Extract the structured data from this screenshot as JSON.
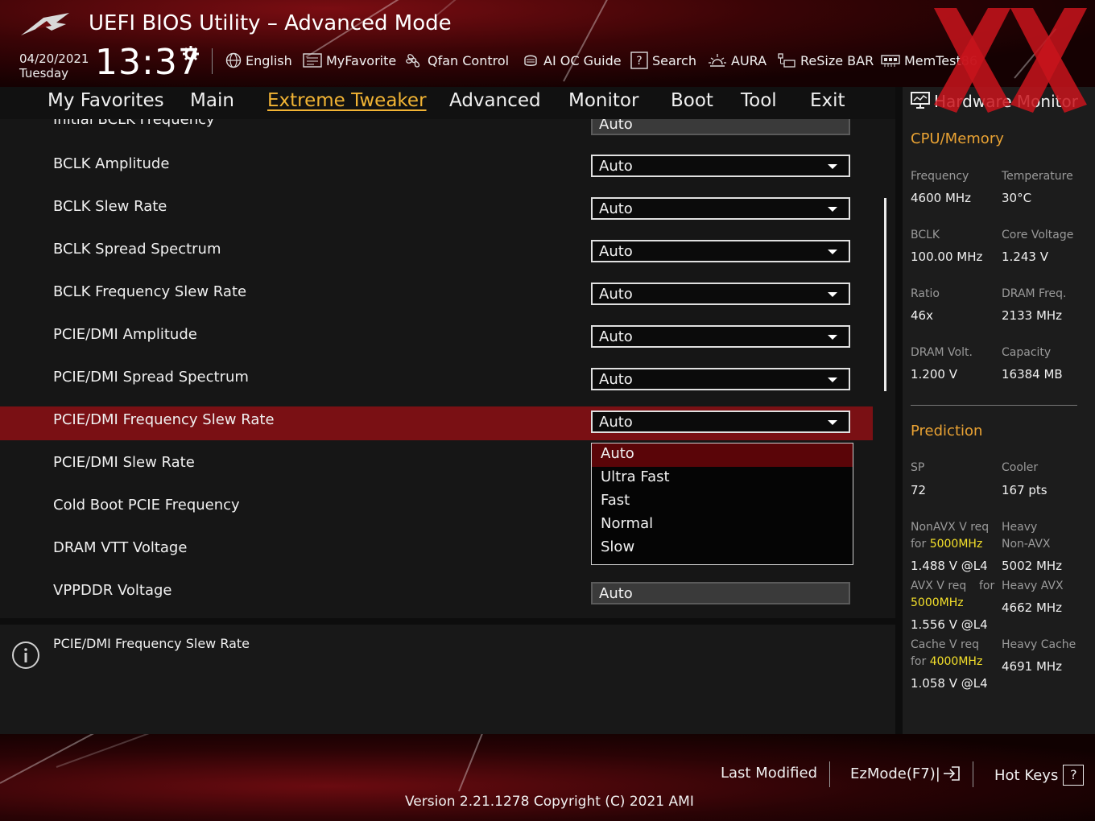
{
  "header": {
    "title": "UEFI BIOS Utility – Advanced Mode",
    "date": "04/20/2021",
    "day": "Tuesday",
    "time": "13:37",
    "tools": [
      {
        "label": "English",
        "icon": "globe-icon"
      },
      {
        "label": "MyFavorite",
        "icon": "favorite-icon"
      },
      {
        "label": "Qfan Control",
        "icon": "fan-icon"
      },
      {
        "label": "AI OC Guide",
        "icon": "ai-oc-icon"
      },
      {
        "label": "Search",
        "icon": "search-icon"
      },
      {
        "label": "AURA",
        "icon": "aura-icon"
      },
      {
        "label": "ReSize BAR",
        "icon": "resize-bar-icon"
      },
      {
        "label": "MemTest86",
        "icon": "memtest-icon"
      }
    ]
  },
  "nav": {
    "tabs": [
      "My Favorites",
      "Main",
      "Extreme Tweaker",
      "Advanced",
      "Monitor",
      "Boot",
      "Tool",
      "Exit"
    ],
    "active": "Extreme Tweaker"
  },
  "settings": {
    "partial_label": "Initial BCLK Frequency",
    "partial_value": "Auto",
    "rows": [
      {
        "label": "BCLK Amplitude",
        "value": "Auto"
      },
      {
        "label": "BCLK Slew Rate",
        "value": "Auto"
      },
      {
        "label": "BCLK Spread Spectrum",
        "value": "Auto"
      },
      {
        "label": "BCLK Frequency Slew Rate",
        "value": "Auto"
      },
      {
        "label": "PCIE/DMI Amplitude",
        "value": "Auto"
      },
      {
        "label": "PCIE/DMI Spread Spectrum",
        "value": "Auto"
      },
      {
        "label": "PCIE/DMI Frequency Slew Rate",
        "value": "Auto"
      },
      {
        "label": "PCIE/DMI Slew Rate",
        "value": ""
      },
      {
        "label": "Cold Boot PCIE Frequency",
        "value": ""
      },
      {
        "label": "DRAM VTT Voltage",
        "value": ""
      },
      {
        "label": "VPPDDR Voltage",
        "value": "Auto"
      }
    ],
    "dropdown_options": [
      "Auto",
      "Ultra Fast",
      "Fast",
      "Normal",
      "Slow"
    ],
    "dropdown_selected": "Auto"
  },
  "help": {
    "text": "PCIE/DMI Frequency Slew Rate"
  },
  "hardware_monitor": {
    "title": "Hardware Monitor",
    "cpu_memory": {
      "heading": "CPU/Memory",
      "frequency_label": "Frequency",
      "frequency": "4600 MHz",
      "temperature_label": "Temperature",
      "temperature": "30°C",
      "bclk_label": "BCLK",
      "bclk": "100.00 MHz",
      "core_voltage_label": "Core Voltage",
      "core_voltage": "1.243 V",
      "ratio_label": "Ratio",
      "ratio": "46x",
      "dram_freq_label": "DRAM Freq.",
      "dram_freq": "2133 MHz",
      "dram_volt_label": "DRAM Volt.",
      "dram_volt": "1.200 V",
      "capacity_label": "Capacity",
      "capacity": "16384 MB"
    },
    "prediction": {
      "heading": "Prediction",
      "sp_label": "SP",
      "sp": "72",
      "cooler_label": "Cooler",
      "cooler": "167 pts",
      "nonavx_req_label": "NonAVX V req",
      "nonavx_for": "for",
      "nonavx_freq": "5000MHz",
      "nonavx_value": "1.488 V @L4",
      "heavy_nonavx_label_1": "Heavy",
      "heavy_nonavx_label_2": "Non-AVX",
      "heavy_nonavx": "5002 MHz",
      "avx_req_label": "AVX V req",
      "avx_for": "for",
      "avx_freq": "5000MHz",
      "avx_value": "1.556 V @L4",
      "heavy_avx_label": "Heavy AVX",
      "heavy_avx": "4662 MHz",
      "cache_req_label": "Cache V req",
      "cache_for": "for",
      "cache_freq": "4000MHz",
      "cache_value": "1.058 V @L4",
      "heavy_cache_label": "Heavy Cache",
      "heavy_cache": "4691 MHz"
    }
  },
  "footer": {
    "last_modified": "Last Modified",
    "ezmode": "EzMode(F7)|",
    "hot_keys": "Hot Keys",
    "hot_keys_key": "?",
    "version": "Version 2.21.1278 Copyright (C) 2021 AMI"
  },
  "colors": {
    "accent": "#f2b434",
    "section_heading": "#e9a233",
    "highlight_row": "#7a1014",
    "yellow_value": "#f4e02a"
  }
}
